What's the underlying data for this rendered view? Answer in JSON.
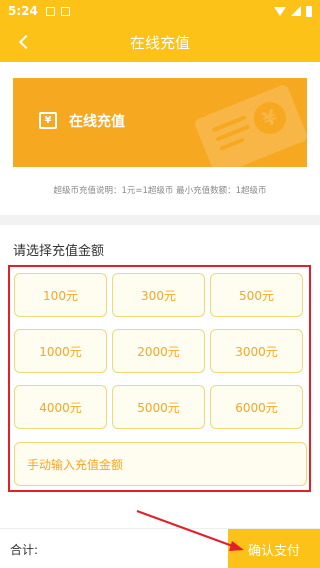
{
  "status_bar": {
    "time": "5:24",
    "notification_icons": [
      "download-notification-icon",
      "photo-notification-icon"
    ],
    "right_icons": [
      "wifi-icon",
      "signal-icon",
      "battery-icon"
    ]
  },
  "nav": {
    "title": "在线充值",
    "back_icon": "back-chevron-icon"
  },
  "banner": {
    "label": "在线充值",
    "icon_glyph": "¥",
    "yen_glyph": "¥"
  },
  "description": "超级币充值说明：1元=1超级币 最小充值数额：1超级币",
  "section_title": "请选择充值金额",
  "amounts": [
    "100元",
    "300元",
    "500元",
    "1000元",
    "2000元",
    "3000元",
    "4000元",
    "5000元",
    "6000元"
  ],
  "manual_input_label": "手动输入充值金额",
  "footer": {
    "total_label": "合计:",
    "confirm_label": "确认支付"
  },
  "colors": {
    "primary_yellow": "#fcc218",
    "banner_orange": "#f7a821",
    "amount_text": "#f6a623",
    "highlight_red": "#e2202a"
  }
}
